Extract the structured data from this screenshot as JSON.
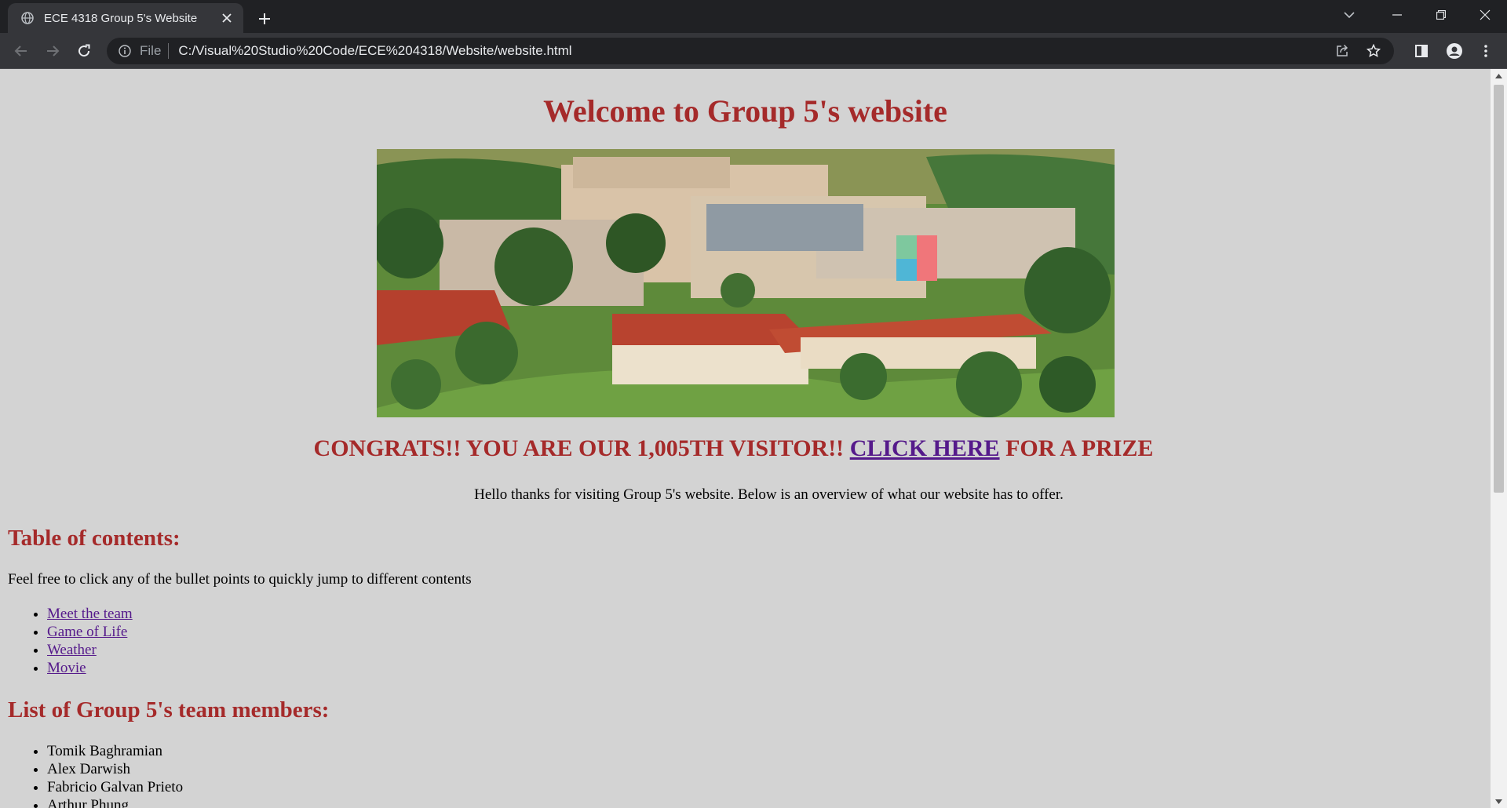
{
  "browser": {
    "tab_title": "ECE 4318 Group 5's Website",
    "omnibox_scheme": "File",
    "url": "C:/Visual%20Studio%20Code/ECE%204318/Website/website.html"
  },
  "page": {
    "title": "Welcome to Group 5's website",
    "congrats_prefix": "CONGRATS!! YOU ARE OUR 1,005TH VISITOR!!",
    "congrats_link": "CLICK HERE",
    "congrats_suffix": "FOR A PRIZE",
    "intro": "Hello thanks for visiting Group 5's website. Below is an overview of what our website has to offer.",
    "toc_heading": "Table of contents:",
    "toc_hint": "Feel free to click any of the bullet points to quickly jump to different contents",
    "toc_items": [
      "Meet the team",
      "Game of Life",
      "Weather",
      "Movie"
    ],
    "team_heading": "List of Group 5's team members:",
    "team_members": [
      "Tomik Baghramian",
      "Alex Darwish",
      "Fabricio Galvan Prieto",
      "Arthur Phung"
    ]
  },
  "colors": {
    "heading": "#a52a2a",
    "visited_link": "#551a8b",
    "page_background": "#d3d3d3",
    "chrome_dark": "#202124",
    "chrome_toolbar": "#35363a"
  }
}
